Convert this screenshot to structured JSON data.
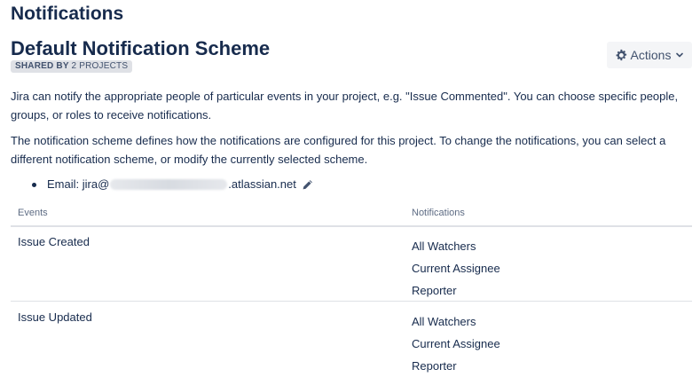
{
  "page_title": "Notifications",
  "scheme": {
    "name": "Default Notification Scheme",
    "shared_label": "SHARED BY",
    "shared_count": "2 PROJECTS"
  },
  "actions": {
    "label": "Actions",
    "icon": "gear-icon",
    "chevron": "chevron-down-icon"
  },
  "description": {
    "p1": "Jira can notify the appropriate people of particular events in your project, e.g. \"Issue Commented\". You can choose specific people, groups, or roles to receive notifications.",
    "p2": "The notification scheme defines how the notifications are configured for this project. To change the notifications, you can select a different notification scheme, or modify the currently selected scheme."
  },
  "email": {
    "prefix": "Email: jira@",
    "suffix": ".atlassian.net",
    "edit_icon": "pencil-icon"
  },
  "table": {
    "headers": {
      "events": "Events",
      "notifications": "Notifications"
    },
    "rows": [
      {
        "event": "Issue Created",
        "notifications": [
          "All Watchers",
          "Current Assignee",
          "Reporter"
        ]
      },
      {
        "event": "Issue Updated",
        "notifications": [
          "All Watchers",
          "Current Assignee",
          "Reporter"
        ]
      }
    ]
  },
  "colors": {
    "text": "#172b4d",
    "muted": "#5e6c84",
    "lozenge_bg": "#dfe1e6",
    "button_bg": "#f4f5f7",
    "divider": "#dfe1e6"
  }
}
